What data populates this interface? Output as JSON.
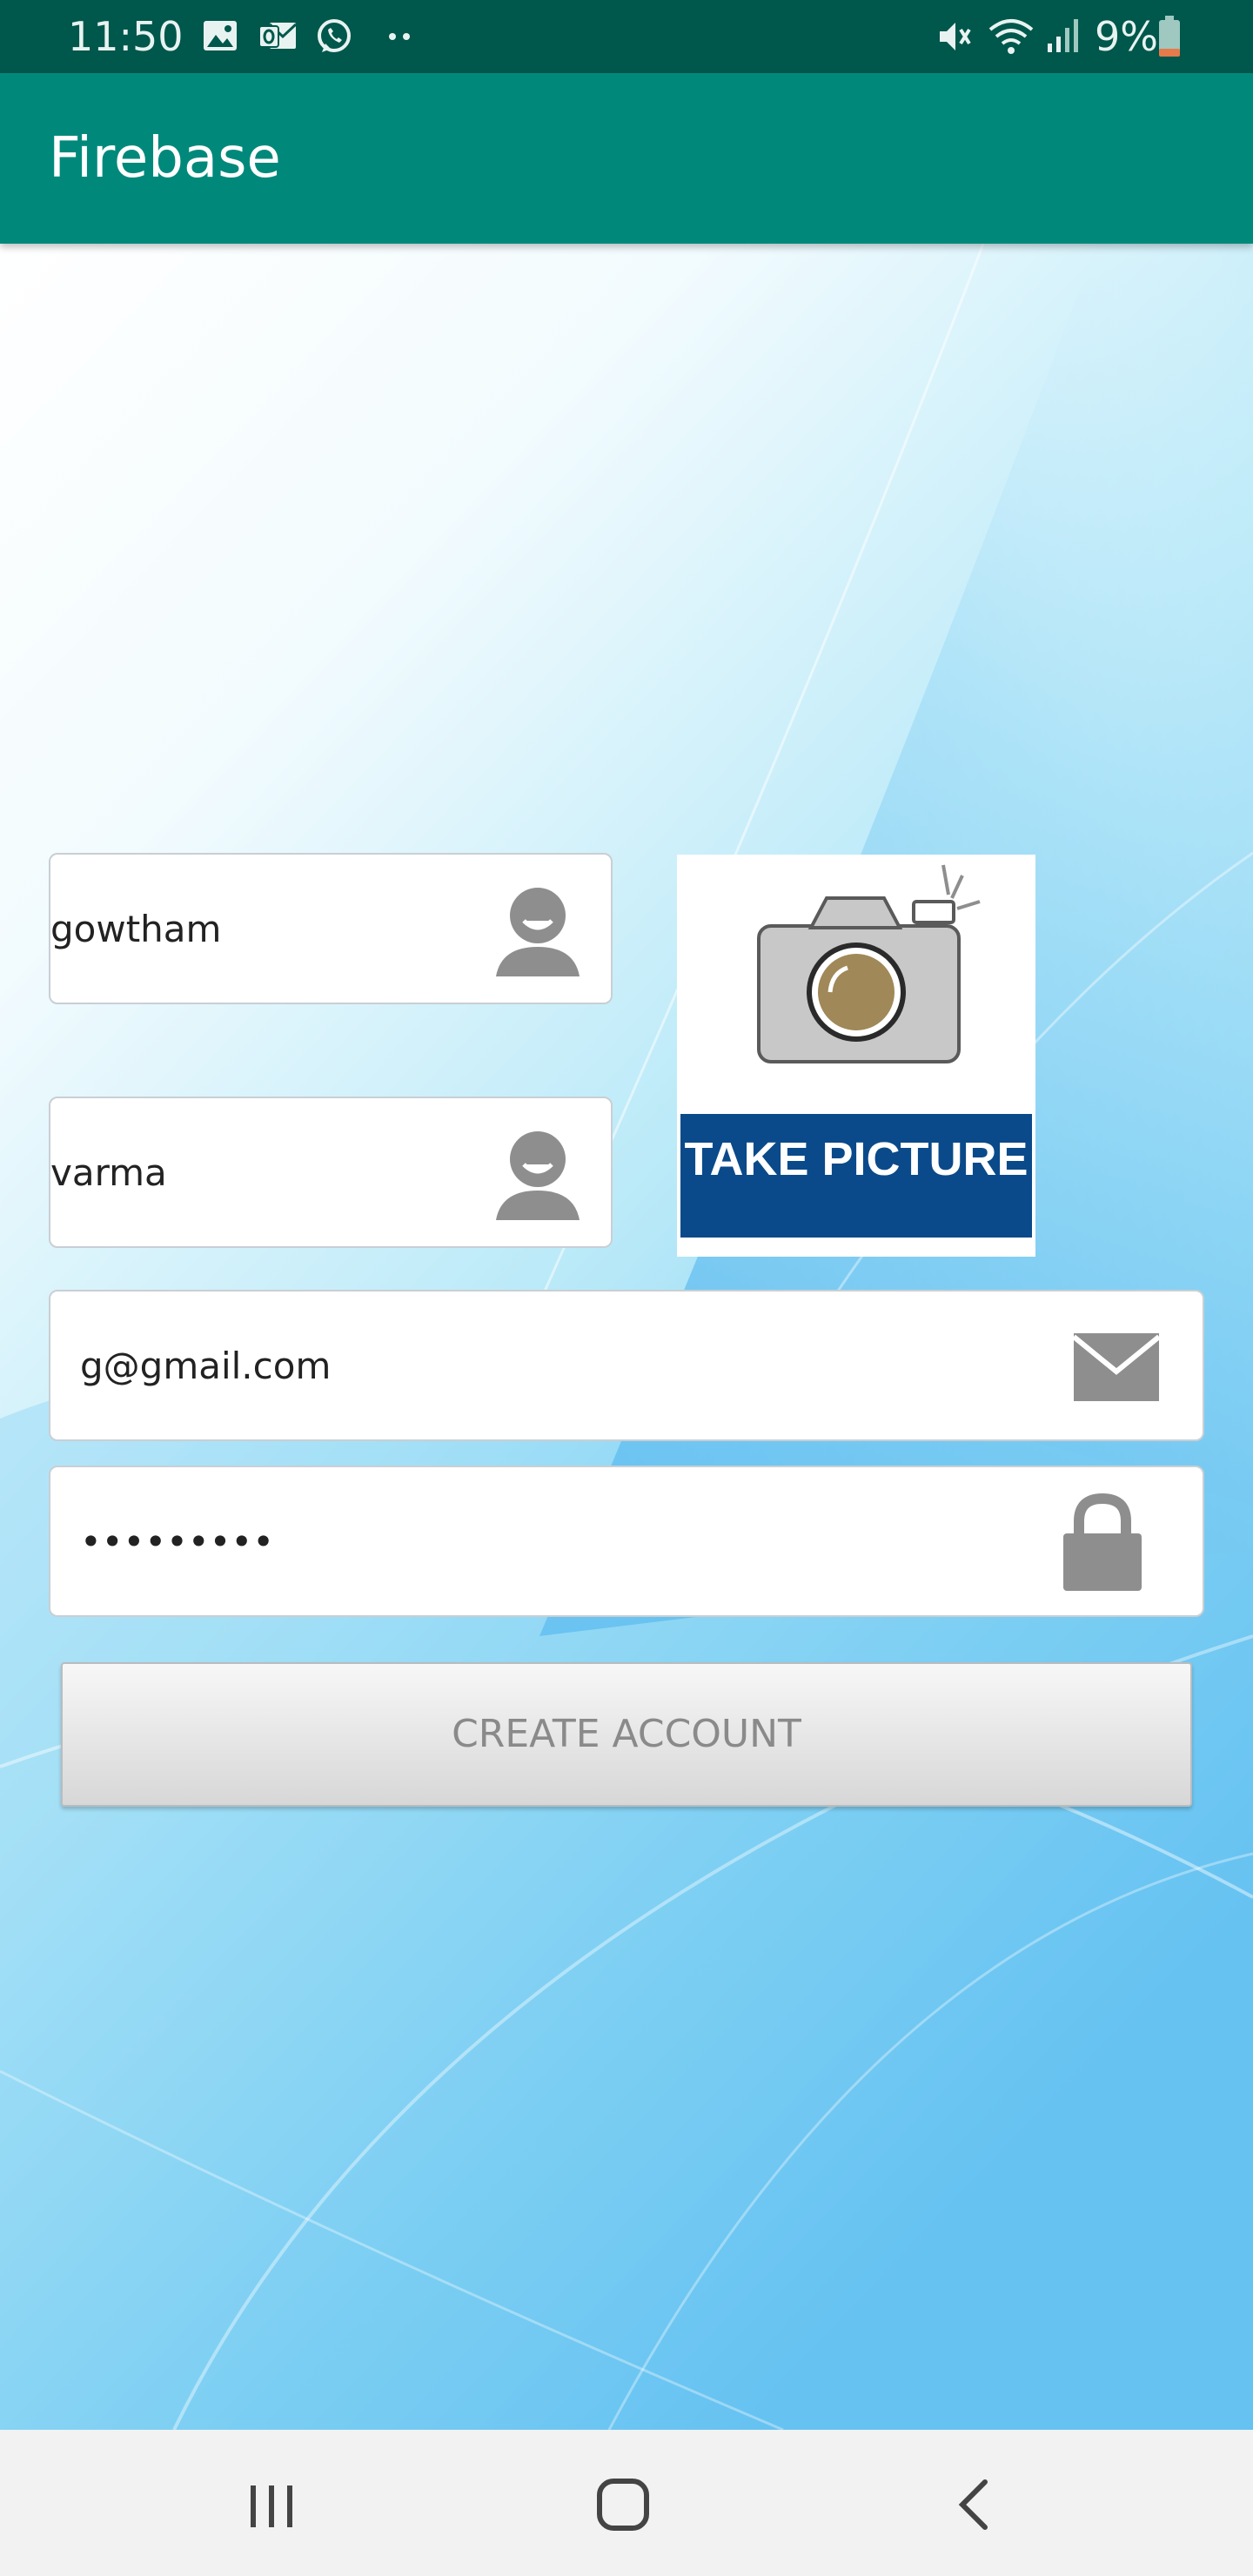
{
  "status_bar": {
    "time": "11:50",
    "battery_text": "9%",
    "icons": [
      "image-icon",
      "outlook-icon",
      "whatsapp-icon",
      "more-dots-icon",
      "mute-icon",
      "wifi-icon",
      "signal-icon",
      "battery-icon"
    ]
  },
  "app_bar": {
    "title": "Firebase"
  },
  "form": {
    "first_name": {
      "value": "gowtham",
      "icon": "person-icon"
    },
    "last_name": {
      "value": "varma",
      "icon": "person-icon"
    },
    "email": {
      "value": "g@gmail.com",
      "icon": "mail-icon"
    },
    "password": {
      "value": "•••••••••",
      "icon": "lock-icon"
    },
    "take_picture_label": "TAKE PICTURE",
    "create_button_label": "CREATE ACCOUNT"
  },
  "colors": {
    "status_bar": "#00574b",
    "app_bar": "#00897b",
    "take_picture_banner": "#0a4a8a",
    "icon_gray": "#8e8e8e"
  },
  "nav_bar": {
    "buttons": [
      "recents-icon",
      "home-icon",
      "back-icon"
    ]
  }
}
